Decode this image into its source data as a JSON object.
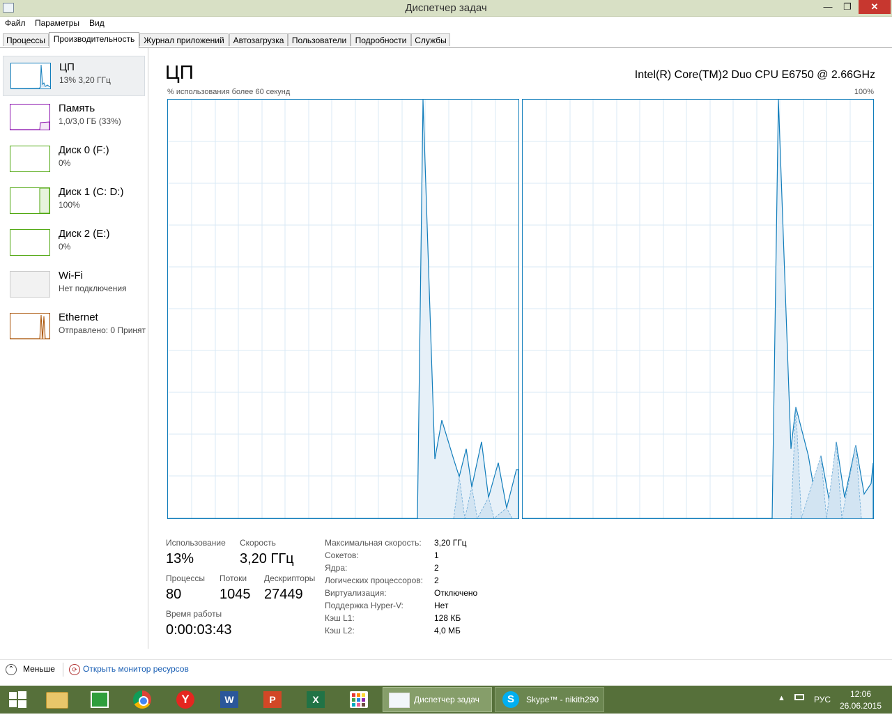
{
  "window": {
    "title": "Диспетчер задач"
  },
  "menu": [
    "Файл",
    "Параметры",
    "Вид"
  ],
  "tabs": [
    "Процессы",
    "Производительность",
    "Журнал приложений",
    "Автозагрузка",
    "Пользователи",
    "Подробности",
    "Службы"
  ],
  "sidebar": [
    {
      "name": "ЦП",
      "value": "13%  3,20 ГГц",
      "color": "#117dbb"
    },
    {
      "name": "Память",
      "value": "1,0/3,0 ГБ (33%)",
      "color": "#8b12ae"
    },
    {
      "name": "Диск 0 (F:)",
      "value": "0%",
      "color": "#4da60c"
    },
    {
      "name": "Диск 1 (C: D:)",
      "value": "100%",
      "color": "#4da60c"
    },
    {
      "name": "Диск 2 (E:)",
      "value": "0%",
      "color": "#4da60c"
    },
    {
      "name": "Wi-Fi",
      "value": "Нет подключения",
      "color": "#cccccc"
    },
    {
      "name": "Ethernet",
      "value": "Отправлено: 0 Принят",
      "color": "#a74f01"
    }
  ],
  "main": {
    "title": "ЦП",
    "cpu_model": "Intel(R) Core(TM)2 Duo CPU E6750 @ 2.66GHz",
    "graph_label": "% использования более 60 секунд",
    "graph_max": "100%",
    "line_color": "#117dbb"
  },
  "stats": {
    "usage_label": "Использование",
    "usage": "13%",
    "speed_label": "Скорость",
    "speed": "3,20 ГГц",
    "processes_label": "Процессы",
    "processes": "80",
    "threads_label": "Потоки",
    "threads": "1045",
    "handles_label": "Дескрипторы",
    "handles": "27449",
    "uptime_label": "Время работы",
    "uptime": "0:00:03:43"
  },
  "info": [
    {
      "label": "Максимальная скорость:",
      "value": "3,20 ГГц"
    },
    {
      "label": "Сокетов:",
      "value": "1"
    },
    {
      "label": "Ядра:",
      "value": "2"
    },
    {
      "label": "Логических процессоров:",
      "value": "2"
    },
    {
      "label": "Виртуализация:",
      "value": "Отключено"
    },
    {
      "label": "Поддержка Hyper-V:",
      "value": "Нет"
    },
    {
      "label": "Кэш L1:",
      "value": "128 КБ"
    },
    {
      "label": "Кэш L2:",
      "value": "4,0 МБ"
    }
  ],
  "footer": {
    "less": "Меньше",
    "monitor": "Открыть монитор ресурсов"
  },
  "taskbar": {
    "apps": [
      {
        "label": "Диспетчер задач"
      },
      {
        "label": "Skype™ - nikith290"
      }
    ],
    "lang": "РУС",
    "time": "12:06",
    "date": "26.06.2015"
  }
}
